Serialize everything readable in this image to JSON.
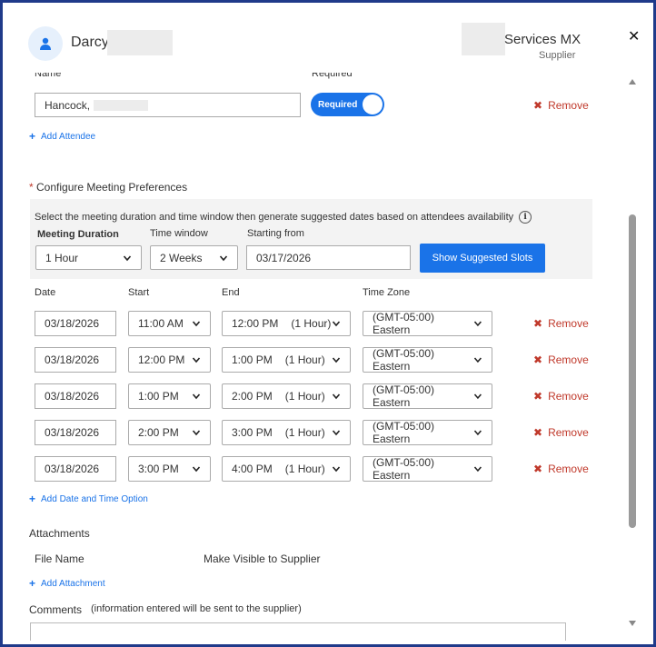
{
  "header": {
    "name": "Darcy",
    "supplier_name": "Services MX",
    "supplier_role": "Supplier",
    "close_label": "✕"
  },
  "attendee": {
    "name_label": "Name",
    "required_label": "Required",
    "name_value": "Hancock,",
    "toggle_label": "Required",
    "remove_label": "Remove",
    "add_attendee_label": "Add Attendee"
  },
  "preferences": {
    "title": "Configure Meeting Preferences",
    "required_mark": "*",
    "description": "Select the meeting duration and time window then generate suggested dates based on attendees availability",
    "info_icon_glyph": "i",
    "duration_label": "Meeting Duration",
    "duration_value": "1 Hour",
    "window_label": "Time window",
    "window_value": "2 Weeks",
    "start_label": "Starting from",
    "start_value": "03/17/2026",
    "suggest_button": "Show Suggested Slots"
  },
  "slots": {
    "headers": {
      "date": "Date",
      "start": "Start",
      "end": "End",
      "timezone": "Time Zone"
    },
    "rows": [
      {
        "date": "03/18/2026",
        "start": "11:00 AM",
        "end": "12:00 PM",
        "duration": "(1 Hour)",
        "timezone": "(GMT-05:00) Eastern",
        "remove": "Remove"
      },
      {
        "date": "03/18/2026",
        "start": "12:00 PM",
        "end": "1:00 PM",
        "duration": "(1 Hour)",
        "timezone": "(GMT-05:00) Eastern",
        "remove": "Remove"
      },
      {
        "date": "03/18/2026",
        "start": "1:00 PM",
        "end": "2:00 PM",
        "duration": "(1 Hour)",
        "timezone": "(GMT-05:00) Eastern",
        "remove": "Remove"
      },
      {
        "date": "03/18/2026",
        "start": "2:00 PM",
        "end": "3:00 PM",
        "duration": "(1 Hour)",
        "timezone": "(GMT-05:00) Eastern",
        "remove": "Remove"
      },
      {
        "date": "03/18/2026",
        "start": "3:00 PM",
        "end": "4:00 PM",
        "duration": "(1 Hour)",
        "timezone": "(GMT-05:00) Eastern",
        "remove": "Remove"
      }
    ],
    "add_option_label": "Add Date and Time Option"
  },
  "attachments": {
    "title": "Attachments",
    "file_name_header": "File Name",
    "visible_header": "Make Visible to Supplier",
    "add_attachment_label": "Add Attachment"
  },
  "comments": {
    "title": "Comments",
    "note": "(information entered will be sent to the supplier)"
  },
  "colors": {
    "accent": "#1a73e8",
    "remove": "#c0392b",
    "frame": "#1f3a8a"
  }
}
